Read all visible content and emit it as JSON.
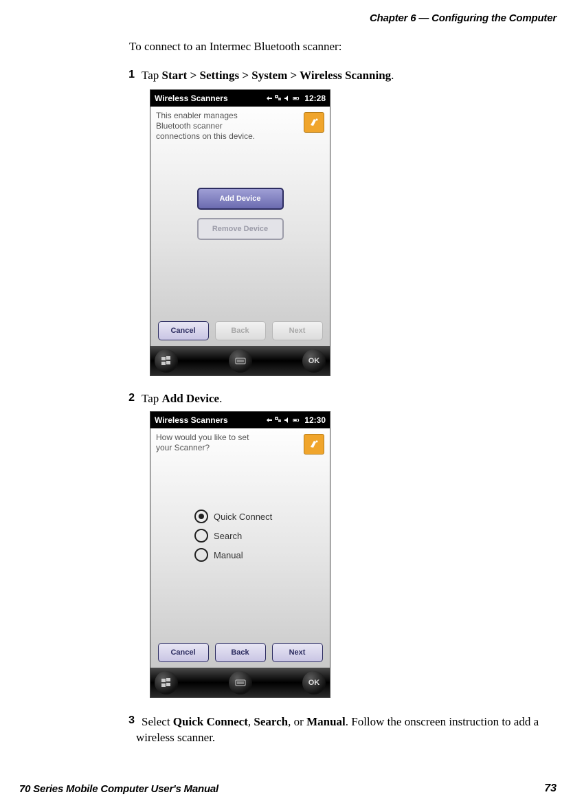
{
  "header": {
    "chapter": "Chapter 6 — Configuring the Computer"
  },
  "intro": "To connect to an Intermec Bluetooth scanner:",
  "steps": {
    "s1": {
      "num": "1",
      "pre": "Tap ",
      "bold": "Start > Settings > System  > Wireless Scanning",
      "post": "."
    },
    "s2": {
      "num": "2",
      "pre": "Tap ",
      "bold": "Add Device",
      "post": "."
    },
    "s3": {
      "num": "3",
      "pre": "Select ",
      "b1": "Quick Connect",
      "sep1": ", ",
      "b2": "Search",
      "sep2": ", or ",
      "b3": "Manual",
      "post": ". Follow the onscreen instruction to add a wireless scanner."
    }
  },
  "shot1": {
    "title": "Wireless Scanners",
    "time": "12:28",
    "msg_l1": "This enabler manages",
    "msg_l2": "Bluetooth scanner",
    "msg_l3": "connections on this device.",
    "btn_add": "Add Device",
    "btn_remove": "Remove Device",
    "btn_cancel": "Cancel",
    "btn_back": "Back",
    "btn_next": "Next",
    "ok": "OK"
  },
  "shot2": {
    "title": "Wireless Scanners",
    "time": "12:30",
    "msg_l1": "How would you like to set",
    "msg_l2": "your Scanner?",
    "opt1": "Quick Connect",
    "opt2": "Search",
    "opt3": "Manual",
    "btn_cancel": "Cancel",
    "btn_back": "Back",
    "btn_next": "Next",
    "ok": "OK"
  },
  "footer": {
    "manual": "70 Series Mobile Computer User's Manual",
    "page": "73"
  }
}
